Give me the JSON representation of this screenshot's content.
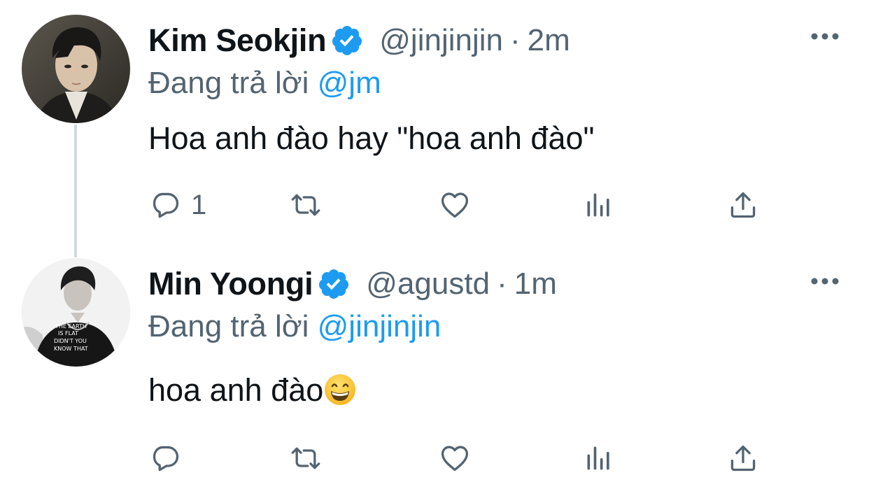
{
  "tweets": [
    {
      "display_name": "Kim Seokjin",
      "handle": "@jinjinjin",
      "separator": "·",
      "time": "2m",
      "reply_prefix": "Đang trả lời",
      "reply_mention": "@jm",
      "text": "Hoa anh đào hay \"hoa anh đào\"",
      "reply_count": "1",
      "verified": true
    },
    {
      "display_name": "Min Yoongi",
      "handle": "@agustd",
      "separator": "·",
      "time": "1m",
      "reply_prefix": "Đang trả lời",
      "reply_mention": "@jinjinjin",
      "text": "hoa anh đào",
      "emoji": "grinning-face",
      "reply_count": "",
      "verified": true
    }
  ],
  "colors": {
    "accent": "#1d9bf0",
    "secondary_text": "#536471",
    "primary_text": "#0f1419",
    "thread_line": "#cfd9de"
  },
  "icons": {
    "verified": "verified-badge-icon",
    "more": "more-options-icon",
    "reply": "reply-icon",
    "retweet": "retweet-icon",
    "like": "heart-icon",
    "analytics": "analytics-icon",
    "share": "share-icon"
  }
}
